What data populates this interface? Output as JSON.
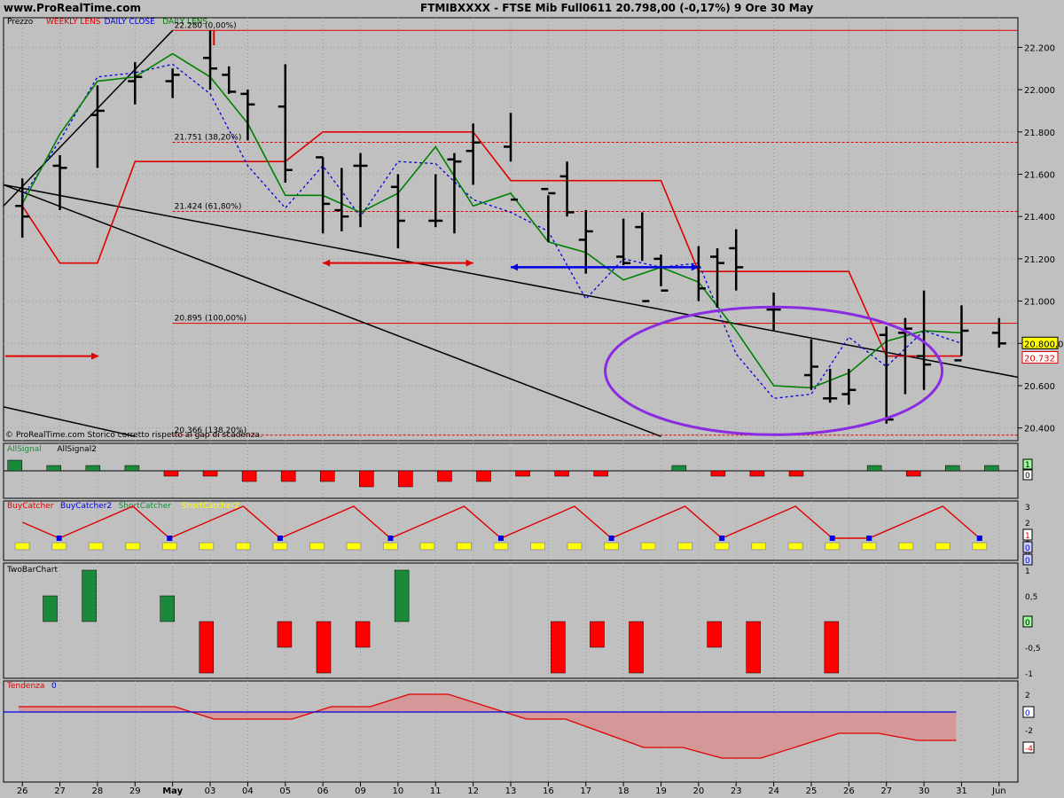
{
  "header": {
    "site": "www.ProRealTime.com",
    "title": "FTMIBXXXX - FTSE Mib Full0611    20.798,00 (-0,17%)    9 Ore  30 May"
  },
  "colors": {
    "background": "#c0c0c0",
    "weekly": "#e00000",
    "daily_close": "#0000e0",
    "daily_lens": "#008000",
    "bars": "#000000",
    "ellipse": "#8a2be2",
    "up": "#1a8a3a",
    "down": "#ff0000",
    "yellow": "#ffff00"
  },
  "chart_data": [
    {
      "panel": "Prezzo",
      "type": "bar",
      "title": "Prezzo",
      "x_labels": [
        "26",
        "27",
        "28",
        "29",
        "May",
        "03",
        "04",
        "05",
        "06",
        "09",
        "10",
        "11",
        "12",
        "13",
        "16",
        "17",
        "18",
        "19",
        "20",
        "23",
        "24",
        "25",
        "26",
        "27",
        "30",
        "31",
        "Jun"
      ],
      "ylim": [
        20340,
        22340
      ],
      "y_ticks": [
        20400,
        20600,
        20800,
        21000,
        21200,
        21400,
        21600,
        21800,
        22000,
        22200
      ],
      "y_tick_labels": [
        "20.400",
        "20.600",
        "20.800",
        "21.000",
        "21.200",
        "21.400",
        "21.600",
        "21.800",
        "22.000",
        "22.200"
      ],
      "legend": [
        {
          "name": "WEEKLY LENS",
          "color": "#e00000"
        },
        {
          "name": "DAILY CLOSE",
          "color": "#0000e0"
        },
        {
          "name": "DAILY LENS",
          "color": "#008000"
        }
      ],
      "ohlc": [
        [
          21450,
          21580,
          21300,
          21400
        ],
        [
          21640,
          21690,
          21430,
          21630
        ],
        [
          21880,
          22020,
          21630,
          21900
        ],
        [
          22040,
          22130,
          21930,
          22060
        ],
        [
          22040,
          22100,
          21960,
          22070
        ],
        [
          22150,
          22280,
          22000,
          22100
        ],
        [
          22070,
          22110,
          21980,
          21990
        ],
        [
          21980,
          22000,
          21760,
          21930
        ],
        [
          21920,
          22120,
          21560,
          21620
        ],
        [
          21680,
          21680,
          21320,
          21460
        ],
        [
          21430,
          21630,
          21330,
          21400
        ],
        [
          21640,
          21700,
          21350,
          21640
        ],
        [
          21540,
          21600,
          21250,
          21380
        ],
        [
          21380,
          21600,
          21350,
          21380
        ],
        [
          21670,
          21700,
          21320,
          21660
        ],
        [
          21710,
          21840,
          21550,
          21750
        ],
        [
          21730,
          21890,
          21660,
          21480
        ],
        [
          21530,
          21500,
          21280,
          21510
        ],
        [
          21590,
          21660,
          21400,
          21420
        ],
        [
          21290,
          21430,
          21130,
          21330
        ],
        [
          21210,
          21390,
          21170,
          21180
        ],
        [
          21350,
          21420,
          21190,
          21000
        ],
        [
          21200,
          21220,
          21070,
          21050
        ],
        [
          21160,
          21260,
          21000,
          21060
        ],
        [
          21210,
          21250,
          20970,
          21180
        ],
        [
          21250,
          21340,
          21050,
          21160
        ],
        [
          20960,
          21040,
          20860,
          20960
        ],
        [
          20650,
          20820,
          20580,
          20690
        ],
        [
          20540,
          20680,
          20520,
          20540
        ],
        [
          20560,
          20680,
          20510,
          20580
        ],
        [
          20840,
          20880,
          20420,
          20440
        ],
        [
          20850,
          20920,
          20560,
          20870
        ],
        [
          20740,
          21050,
          20580,
          20700
        ],
        [
          20720,
          20980,
          20740,
          20860
        ],
        [
          20850,
          20920,
          20780,
          20800
        ]
      ],
      "x_slots": [
        0.5,
        1.5,
        2.5,
        3.5,
        4.5,
        5.5,
        6.0,
        6.5,
        7.5,
        8.5,
        9.0,
        9.5,
        10.5,
        11.5,
        12.0,
        12.5,
        13.5,
        14.5,
        15.0,
        15.5,
        16.5,
        17.0,
        17.5,
        18.5,
        19.0,
        19.5,
        20.5,
        21.5,
        22.0,
        22.5,
        23.5,
        24.0,
        24.5,
        25.5,
        26.5,
        27.5
      ],
      "daily_close": [
        [
          0.5,
          21490
        ],
        [
          1.5,
          21760
        ],
        [
          2.5,
          22060
        ],
        [
          3.5,
          22080
        ],
        [
          4.5,
          22120
        ],
        [
          5.5,
          21980
        ],
        [
          6.5,
          21640
        ],
        [
          7.5,
          21440
        ],
        [
          8.5,
          21640
        ],
        [
          9.5,
          21400
        ],
        [
          10.5,
          21660
        ],
        [
          11.5,
          21650
        ],
        [
          12.5,
          21480
        ],
        [
          13.5,
          21420
        ],
        [
          14.5,
          21330
        ],
        [
          15.5,
          21010
        ],
        [
          16.5,
          21200
        ],
        [
          17.5,
          21160
        ],
        [
          18.5,
          21180
        ],
        [
          19.5,
          20750
        ],
        [
          20.5,
          20540
        ],
        [
          21.5,
          20560
        ],
        [
          22.5,
          20830
        ],
        [
          23.5,
          20690
        ],
        [
          24.5,
          20860
        ],
        [
          25.5,
          20800
        ]
      ],
      "daily_lens": [
        [
          0.5,
          21460
        ],
        [
          1.5,
          21790
        ],
        [
          2.5,
          22040
        ],
        [
          3.5,
          22060
        ],
        [
          4.5,
          22170
        ],
        [
          5.5,
          22060
        ],
        [
          6.5,
          21840
        ],
        [
          7.5,
          21500
        ],
        [
          8.5,
          21500
        ],
        [
          9.5,
          21420
        ],
        [
          10.5,
          21510
        ],
        [
          11.5,
          21730
        ],
        [
          12.5,
          21450
        ],
        [
          13.5,
          21510
        ],
        [
          14.5,
          21280
        ],
        [
          15.5,
          21230
        ],
        [
          16.5,
          21100
        ],
        [
          17.5,
          21160
        ],
        [
          18.5,
          21090
        ],
        [
          19.5,
          20860
        ],
        [
          20.5,
          20600
        ],
        [
          21.5,
          20590
        ],
        [
          22.5,
          20660
        ],
        [
          23.5,
          20810
        ],
        [
          24.5,
          20860
        ],
        [
          25.5,
          20850
        ]
      ],
      "weekly_lens": [
        [
          0.5,
          21450
        ],
        [
          1.5,
          21180
        ],
        [
          2.5,
          21180
        ],
        [
          3.5,
          21660
        ],
        [
          4.5,
          21660
        ],
        [
          5.5,
          21660
        ],
        [
          6.5,
          21660
        ],
        [
          7.5,
          21660
        ],
        [
          8.5,
          21800
        ],
        [
          9.5,
          21800
        ],
        [
          10.5,
          21800
        ],
        [
          11.5,
          21800
        ],
        [
          12.5,
          21800
        ],
        [
          13.5,
          21570
        ],
        [
          14.5,
          21570
        ],
        [
          15.5,
          21570
        ],
        [
          16.5,
          21570
        ],
        [
          17.5,
          21570
        ],
        [
          18.5,
          21140
        ],
        [
          19.5,
          21140
        ],
        [
          20.5,
          21140
        ],
        [
          21.5,
          21140
        ],
        [
          22.5,
          21140
        ],
        [
          23.5,
          20740
        ],
        [
          24.5,
          20740
        ],
        [
          25.5,
          20740
        ]
      ],
      "fib_levels": [
        {
          "value": 22280,
          "label": "22.280 (0,00%)"
        },
        {
          "value": 21751,
          "label": "21.751 (38,20%)"
        },
        {
          "value": 21424,
          "label": "21.424 (61,80%)"
        },
        {
          "value": 20895,
          "label": "20.895 (100,00%)"
        },
        {
          "value": 20366,
          "label": "20.366 (138,20%)"
        }
      ],
      "price_tags": [
        {
          "value": 20800,
          "label": "20.800,0"
        },
        {
          "value": 20732,
          "label": "20.732"
        }
      ],
      "footer_note": "© ProRealTime.com  Storico corretto rispetto al gap di scadenza."
    },
    {
      "panel": "AllSignal",
      "type": "bar",
      "legend": [
        "AllSignal",
        "AllSignal2"
      ],
      "values": [
        1,
        0.5,
        0.5,
        0.5,
        -0.5,
        -0.5,
        -1,
        -1,
        -1,
        -1.5,
        -1.5,
        -1,
        -1,
        -0.5,
        -0.5,
        -0.5,
        0,
        0.5,
        -0.5,
        -0.5,
        -0.5,
        0,
        0.5,
        -0.5,
        0.5,
        0.5
      ],
      "tags": [
        "1",
        "0"
      ]
    },
    {
      "panel": "BuyCatcher",
      "type": "line",
      "legend": [
        "BuyCatcher",
        "BuyCatcher2",
        "ShortCatcher",
        "ShortCatcher2"
      ],
      "y_tick_labels": [
        "3",
        "2",
        "1",
        "0"
      ],
      "line": [
        2,
        1,
        2,
        3,
        1,
        2,
        3,
        1,
        2,
        3,
        1,
        2,
        3,
        1,
        2,
        3,
        1,
        2,
        3,
        1,
        2,
        3,
        1,
        1,
        2,
        3,
        1
      ],
      "tags": [
        "1",
        "0",
        "0"
      ]
    },
    {
      "panel": "TwoBarChart",
      "type": "bar",
      "legend": [
        "TwoBarChart"
      ],
      "y_tick_labels": [
        "1",
        "0,5",
        "0",
        "-0,5",
        "-1"
      ],
      "values": [
        0,
        0.5,
        1,
        0,
        0.5,
        -1,
        0,
        -0.5,
        -1,
        -0.5,
        1,
        0,
        0,
        0,
        -1,
        -0.5,
        -1,
        0,
        -0.5,
        -1,
        0,
        -1,
        0,
        0,
        0
      ],
      "tags": [
        "0"
      ]
    },
    {
      "panel": "Tendenza",
      "type": "area",
      "legend": [
        "Tendenza",
        "0"
      ],
      "y_tick_labels": [
        "2",
        "0",
        "-2",
        "-4"
      ],
      "values": [
        0.6,
        0.6,
        0.6,
        0.6,
        0.6,
        -0.8,
        -0.8,
        -0.8,
        0.6,
        0.6,
        2,
        2,
        0.6,
        -0.8,
        -0.8,
        -2.4,
        -4,
        -4,
        -5.2,
        -5.2,
        -3.8,
        -2.4,
        -2.4,
        -3.2,
        -3.2
      ],
      "tags": [
        "0",
        "-4"
      ]
    }
  ]
}
